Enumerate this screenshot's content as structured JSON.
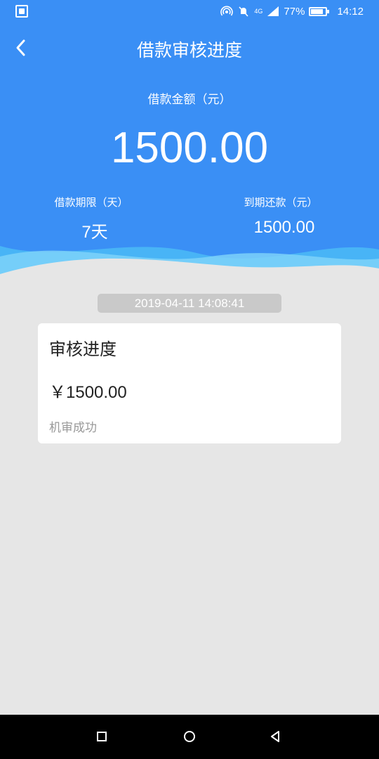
{
  "status_bar": {
    "battery": "77%",
    "time": "14:12",
    "network": "4G",
    "icons": [
      "app-icon",
      "hotspot-icon",
      "mute-icon",
      "signal-icon",
      "battery-icon"
    ]
  },
  "nav": {
    "title": "借款审核进度",
    "back_icon": "chevron-left-icon"
  },
  "loan": {
    "amount_label": "借款金额（元）",
    "amount": "1500.00",
    "term_label": "借款期限（天）",
    "term_value": "7天",
    "due_label": "到期还款（元）",
    "due_value": "1500.00"
  },
  "record": {
    "timestamp": "2019-04-11 14:08:41",
    "title": "审核进度",
    "amount": "￥1500.00",
    "status": "机审成功"
  },
  "colors": {
    "header": "#3a8ff5",
    "background": "#e6e6e6",
    "card": "#ffffff",
    "muted_text": "#999999"
  },
  "system_nav": {
    "icons": [
      "square-icon",
      "circle-icon",
      "triangle-back-icon"
    ]
  }
}
